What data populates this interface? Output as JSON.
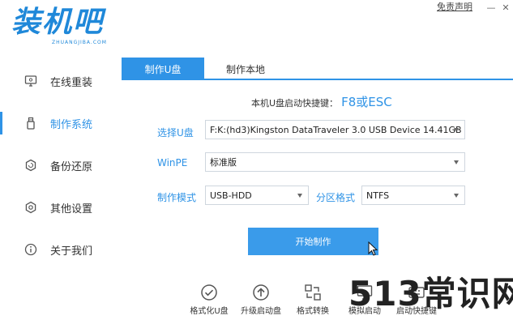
{
  "app": {
    "logo_text": "装机吧",
    "logo_sub": "ZHUANGJIBA.COM",
    "disclaimer": "免责声明",
    "minimize": "—",
    "close": "✕"
  },
  "sidebar": {
    "items": [
      {
        "label": "在线重装",
        "icon": "monitor-icon"
      },
      {
        "label": "制作系统",
        "icon": "usb-icon",
        "active": true
      },
      {
        "label": "备份还原",
        "icon": "backup-icon"
      },
      {
        "label": "其他设置",
        "icon": "gear-icon"
      },
      {
        "label": "关于我们",
        "icon": "info-icon"
      }
    ]
  },
  "tabs": [
    {
      "label": "制作U盘",
      "active": true
    },
    {
      "label": "制作本地",
      "active": false
    }
  ],
  "form": {
    "hotkey_label": "本机U盘启动快捷键：",
    "hotkey_value": "F8或ESC",
    "usb_label": "选择U盘",
    "usb_value": "F:K:(hd3)Kingston DataTraveler 3.0 USB Device 14.41GB",
    "winpe_label": "WinPE",
    "winpe_value": "标准版",
    "mode_label": "制作模式",
    "mode_value": "USB-HDD",
    "partition_label": "分区格式",
    "partition_value": "NTFS",
    "start_button": "开始制作"
  },
  "tools": [
    {
      "label": "格式化U盘",
      "icon": "check-circle-icon"
    },
    {
      "label": "升级启动盘",
      "icon": "upload-circle-icon"
    },
    {
      "label": "格式转换",
      "icon": "convert-icon"
    },
    {
      "label": "模拟启动",
      "icon": "simulate-icon"
    },
    {
      "label": "启动快捷键",
      "icon": "keyboard-icon"
    }
  ],
  "watermark": "513常识网",
  "colors": {
    "accent": "#2f93e6",
    "button": "#3a9bea",
    "logo": "#1f88d9"
  }
}
